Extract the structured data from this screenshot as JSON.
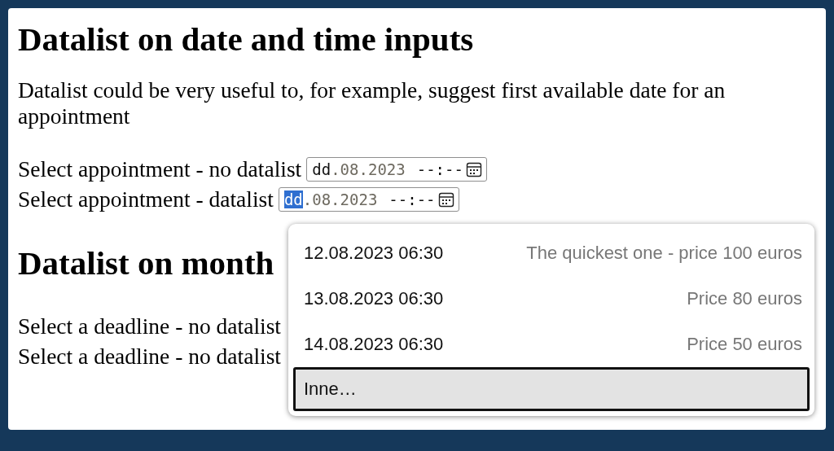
{
  "sections": [
    {
      "heading": "Datalist on date and time inputs",
      "paragraph": "Datalist could be very useful to, for example, suggest first available date for an appointment",
      "rows": [
        {
          "label": "Select appointment - no datalist",
          "input": {
            "segments": [
              {
                "text": "dd",
                "dim": false,
                "selected": false
              },
              {
                "text": ".",
                "dim": true,
                "selected": false
              },
              {
                "text": "08",
                "dim": true,
                "selected": false
              },
              {
                "text": ".",
                "dim": true,
                "selected": false
              },
              {
                "text": "2023",
                "dim": true,
                "selected": false
              },
              {
                "text": "--:--",
                "dim": false,
                "selected": false
              }
            ]
          }
        },
        {
          "label": "Select appointment - datalist",
          "input": {
            "segments": [
              {
                "text": "dd",
                "dim": false,
                "selected": true
              },
              {
                "text": ".",
                "dim": true,
                "selected": false
              },
              {
                "text": "08",
                "dim": true,
                "selected": false
              },
              {
                "text": ".",
                "dim": true,
                "selected": false
              },
              {
                "text": "2023",
                "dim": true,
                "selected": false
              },
              {
                "text": "--:--",
                "dim": false,
                "selected": false
              }
            ]
          }
        }
      ]
    },
    {
      "heading": "Datalist on month",
      "rows": [
        {
          "label": "Select a deadline - no datalist"
        },
        {
          "label": "Select a deadline - no datalist"
        }
      ]
    }
  ],
  "dropdown": {
    "options": [
      {
        "value": "12.08.2023 06:30",
        "label": "The quickest one - price 100 euros",
        "selected": false
      },
      {
        "value": "13.08.2023 06:30",
        "label": "Price 80 euros",
        "selected": false
      },
      {
        "value": "14.08.2023 06:30",
        "label": "Price 50 euros",
        "selected": false
      },
      {
        "value": "Inne…",
        "selected": true
      }
    ]
  }
}
